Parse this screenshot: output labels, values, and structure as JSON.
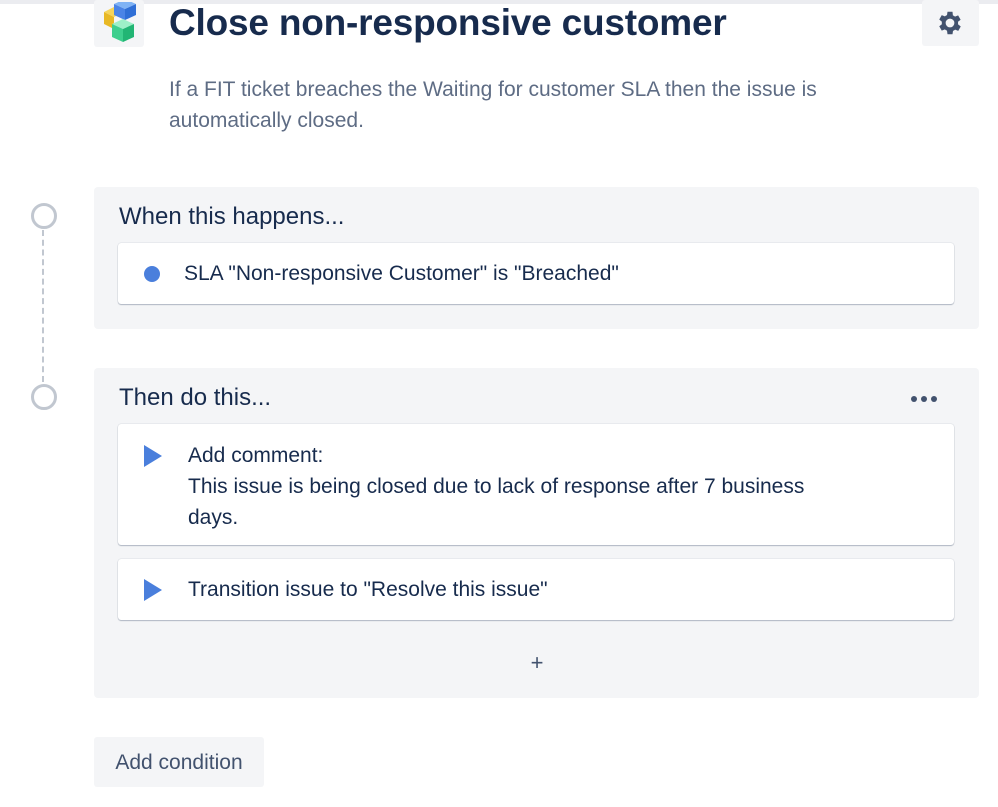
{
  "rule": {
    "title": "Close non-responsive customer",
    "description": "If a FIT ticket breaches the Waiting for customer SLA then the issue is automatically closed."
  },
  "icons": {
    "app": "stacked-cubes-icon",
    "settings": "gear-icon",
    "more": "more-horizontal-icon",
    "trigger": "dot-icon",
    "action": "play-icon",
    "add": "plus-icon"
  },
  "trigger_section": {
    "heading": "When this happens...",
    "items": [
      {
        "label": "SLA \"Non-responsive Customer\" is \"Breached\""
      }
    ]
  },
  "action_section": {
    "heading": "Then do this...",
    "items": [
      {
        "title": "Add comment:",
        "body": "This issue is being closed due to lack of response after 7 business days."
      },
      {
        "title": "Transition issue to \"Resolve this issue\""
      }
    ],
    "add_label": "+"
  },
  "footer": {
    "add_condition_label": "Add condition"
  },
  "colors": {
    "accent": "#4a7fdc",
    "text": "#172b4d",
    "muted": "#5e6c84",
    "panel": "#f4f5f7"
  }
}
